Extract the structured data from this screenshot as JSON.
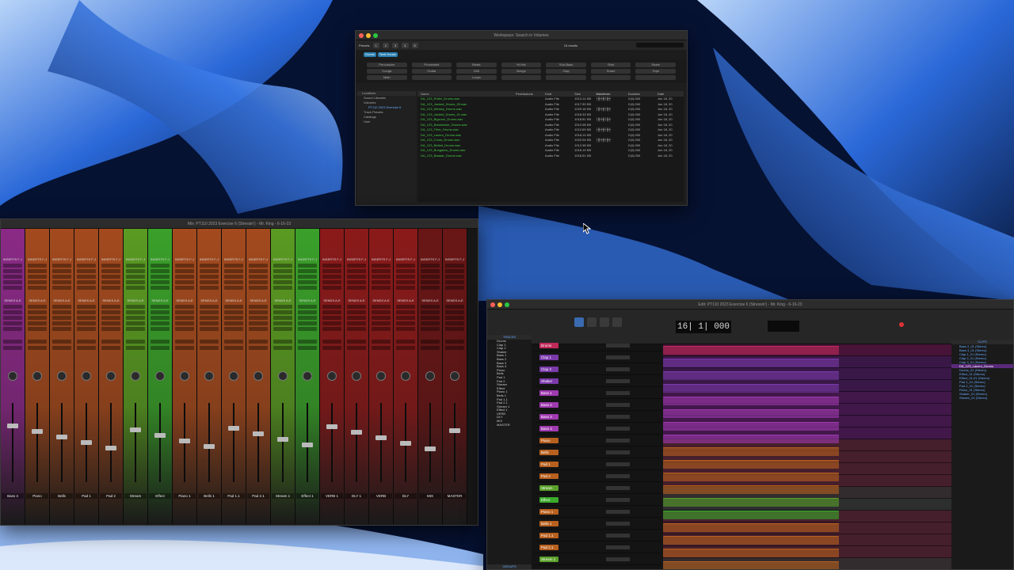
{
  "workspace": {
    "title": "Workspace: Search in Volumes",
    "results": "15 results",
    "presets_label": "Presets",
    "preset_numbers": [
      "1",
      "2",
      "3",
      "4",
      "5"
    ],
    "tags": [
      "Drums",
      "Tech House"
    ],
    "categories": [
      "Percussion",
      "Processed",
      "Beats",
      "Hi-Hat",
      "Sub-Bass",
      "Shot",
      "Snare",
      "Conga",
      "Guitar",
      "Drill",
      "Bongo",
      "Clap",
      "Snare",
      "Tops",
      "Main",
      "",
      "Loops",
      "",
      "",
      "",
      ""
    ],
    "location_header": "Locations",
    "locations": [
      "Sound Libraries",
      "Volumes",
      "PT110 2023 Exercise 6",
      "Track Presets",
      "Catalogs",
      "User"
    ],
    "file_header": [
      "Name",
      "Permissions",
      "Kind",
      "Size",
      "Waveform",
      "Duration",
      "Date"
    ],
    "files": [
      {
        "name": "DA_123_Roller_Drums.wav",
        "kind": "Audio File",
        "size": "1013.14 KB",
        "duration": "2:|0|.000",
        "date": "Jun 18, 20"
      },
      {
        "name": "DA_123_Jacked_Drums_03.wav",
        "kind": "Audio File",
        "size": "1017.59 KB",
        "duration": "2:|0|.000",
        "date": "Jun 18, 20"
      },
      {
        "name": "DA_123_Wesley_Drums.wav",
        "kind": "Audio File",
        "size": "1020.18 KB",
        "duration": "2:|0|.000",
        "date": "Jun 18, 20"
      },
      {
        "name": "DA_123_Jacked_Drums_01.wav",
        "kind": "Audio File",
        "size": "1018.33 KB",
        "duration": "2:|0|.000",
        "date": "Jun 18, 20"
      },
      {
        "name": "DA_123_Bigzone_Drums.wav",
        "kind": "Audio File",
        "size": "1018.81 KB",
        "duration": "2:|0|.000",
        "date": "Jun 18, 20"
      },
      {
        "name": "DA_123_Backstroke_Drums.wav",
        "kind": "Audio File",
        "size": "1012.98 KB",
        "duration": "2:|0|.000",
        "date": "Jun 18, 20"
      },
      {
        "name": "DA_123_Tribe_Drums.wav",
        "kind": "Audio File",
        "size": "1012.69 KB",
        "duration": "2:|0|.000",
        "date": "Jun 18, 20"
      },
      {
        "name": "DA_123_Lacero_Drums.wav",
        "kind": "Audio File",
        "size": "1018.14 KB",
        "duration": "2:|0|.000",
        "date": "Jun 18, 20"
      },
      {
        "name": "DA_123_Cross_Drums.wav",
        "kind": "Audio File",
        "size": "1020.94 KB",
        "duration": "2:|0|.000",
        "date": "Jun 18, 20"
      },
      {
        "name": "DA_123_Belted_Drums.wav",
        "kind": "Audio File",
        "size": "1012.98 KB",
        "duration": "2:|0|.000",
        "date": "Jun 18, 20"
      },
      {
        "name": "DA_123_Bungalow_Drums.wav",
        "kind": "Audio File",
        "size": "1016.19 KB",
        "duration": "2:|0|.000",
        "date": "Jun 18, 20"
      },
      {
        "name": "DA_123_Baaaar_Drums.wav",
        "kind": "Audio File",
        "size": "1016.51 KB",
        "duration": "2:|0|.000",
        "date": "Jun 18, 20"
      }
    ]
  },
  "mix": {
    "title": "Mix: PT110 2023 Exercise 6 (Stressin') - Mr. King - 6-16-23",
    "inserts_label": "INSERTS F-J",
    "sends_label": "SENDS A-E",
    "strips": [
      {
        "name": "Bass 4",
        "color": "#8a2a86"
      },
      {
        "name": "Piano",
        "color": "#a34a1e"
      },
      {
        "name": "Bells",
        "color": "#a34a1e"
      },
      {
        "name": "Pad 1",
        "color": "#a34a1e"
      },
      {
        "name": "Pad 2",
        "color": "#a34a1e"
      },
      {
        "name": "Stream",
        "color": "#5a9a22"
      },
      {
        "name": "Effect",
        "color": "#3aa02a"
      },
      {
        "name": "Piano 1",
        "color": "#a34a1e"
      },
      {
        "name": "Bells 1",
        "color": "#a34a1e"
      },
      {
        "name": "Pad 1.1",
        "color": "#a34a1e"
      },
      {
        "name": "Pad 2.1",
        "color": "#a34a1e"
      },
      {
        "name": "Stream 1",
        "color": "#5a9a22"
      },
      {
        "name": "Effect 1",
        "color": "#3aa02a"
      },
      {
        "name": "VERB 1",
        "color": "#8a1a1a"
      },
      {
        "name": "DLY 1",
        "color": "#8a1a1a"
      },
      {
        "name": "VERB",
        "color": "#8a1a1a"
      },
      {
        "name": "DLY",
        "color": "#8a1a1a"
      },
      {
        "name": "MIX",
        "color": "#6a1616"
      },
      {
        "name": "MASTER",
        "color": "#6a1616"
      }
    ]
  },
  "edit": {
    "title": "Edit: PT110 2023 Exercise 6 (Stressin') - Mr. King - 6-16-23",
    "counter": "16| 1| 000",
    "tracks_header": "TRACKS",
    "groups_header": "GROUPS",
    "clips_header": "CLIPS",
    "track_list": [
      "Drums",
      "Clap 1",
      "Clap 2",
      "Shaker",
      "Bass 1",
      "Bass 2",
      "Bass 3",
      "Bass 4",
      "Piano",
      "Bells",
      "Pad 1",
      "Pad 2",
      "Stream",
      "Effect",
      "Piano 1",
      "Bells 1",
      "Pad 1.1",
      "Pad 2.1",
      "Stream 1",
      "Effect 1",
      "VERB",
      "DLY",
      "MIX",
      "MASTER"
    ],
    "tracks": [
      {
        "name": "Drums",
        "color": "#c02a5a"
      },
      {
        "name": "Clap 1",
        "color": "#7a3aaa"
      },
      {
        "name": "Clap 2",
        "color": "#7a3aaa"
      },
      {
        "name": "Shaker",
        "color": "#7a3aaa"
      },
      {
        "name": "Bass 1",
        "color": "#a03ab0"
      },
      {
        "name": "Bass 2",
        "color": "#a03ab0"
      },
      {
        "name": "Bass 3",
        "color": "#a03ab0"
      },
      {
        "name": "Bass 4",
        "color": "#a03ab0"
      },
      {
        "name": "Piano",
        "color": "#b8601e"
      },
      {
        "name": "Bells",
        "color": "#b8601e"
      },
      {
        "name": "Pad 1",
        "color": "#b8601e"
      },
      {
        "name": "Pad 2",
        "color": "#b8601e"
      },
      {
        "name": "Stream",
        "color": "#5aa02a"
      },
      {
        "name": "Effect",
        "color": "#3aaa2a"
      },
      {
        "name": "Piano 1",
        "color": "#b8601e"
      },
      {
        "name": "Bells 1",
        "color": "#b8601e"
      },
      {
        "name": "Pad 1.1",
        "color": "#b8601e"
      },
      {
        "name": "Pad 2.1",
        "color": "#b8601e"
      },
      {
        "name": "Stream 1",
        "color": "#5aa02a"
      }
    ],
    "clips": [
      "Bass 2_01 (Stereo)",
      "Bass 3_01 (Stereo)",
      "Clap 1_01 (Stereo)",
      "Clap 2_01 (Stereo)",
      "Clap 3_01 (Stereo)",
      "DA_123_Lacero_Drums",
      "Drums_01 (Stereo)",
      "Effect_01 (Stereo)",
      "Effect_01-01 (Stereo)",
      "Pad 1_01 (Stereo)",
      "Pad 2_01 (Stereo)",
      "Piano_01 (Stereo)",
      "Shaker_01 (Stereo)",
      "Stream_01 (Stereo)"
    ]
  }
}
